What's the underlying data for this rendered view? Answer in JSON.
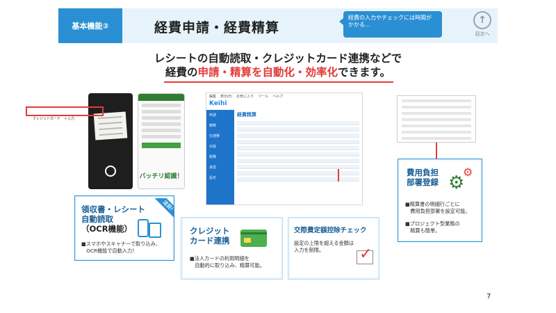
{
  "header": {
    "badge": "基本機能②",
    "title": "経費申請・経費精算",
    "bubble": "経費の入力やチェックには時間が\nかかる…",
    "toc_arrow": "↑",
    "toc_label": "目次へ"
  },
  "headline": {
    "line1": "レシートの自動読取・クレジットカード連携などで",
    "line2_prefix": "経費の",
    "line2_highlight": "申請・精算を自動化・効率化",
    "line2_suffix": "できます。"
  },
  "phone2": {
    "catch": "バッチリ認識！"
  },
  "app": {
    "logo": "Keihi",
    "menu": [
      "編集",
      "表示(E)",
      "お気に入り",
      "ツール",
      "ヘルプ"
    ],
    "sidebar": [
      "申請",
      "精算",
      "交通費",
      "出張",
      "経費",
      "承認",
      "設定"
    ],
    "screen_title": "経費精算",
    "redbox_label": "クレジットカード　＋入力"
  },
  "cards": {
    "ocr": {
      "ribbon": "注目！",
      "title_line1": "領収書・レシート",
      "title_line2": "自動読取",
      "title_line3": "（OCR機能）",
      "desc": "■スマホやスキャナーで取り込み、\n　OCR機能で自動入力！"
    },
    "credit": {
      "title_line1": "クレジット",
      "title_line2": "カード連携",
      "desc": "■法人カードの利用明細を\n　自動的に取り込み、精算可能。"
    },
    "check": {
      "title": "交際費定額控除チェック",
      "desc": "設定の上限を超える金額は\n入力を制限。"
    },
    "burden": {
      "title_line1": "費用負担",
      "title_line2": "部署登録",
      "desc1": "■精算書の明細行ごとに\n　費用負担部署を設定可能。",
      "desc2": "■プロジェクト型業務の\n　精算も簡単。"
    }
  },
  "page_number": "7",
  "colors": {
    "brand_blue": "#2a8fd3",
    "accent_red": "#e23b3b",
    "header_bg": "#e7f3fb"
  }
}
